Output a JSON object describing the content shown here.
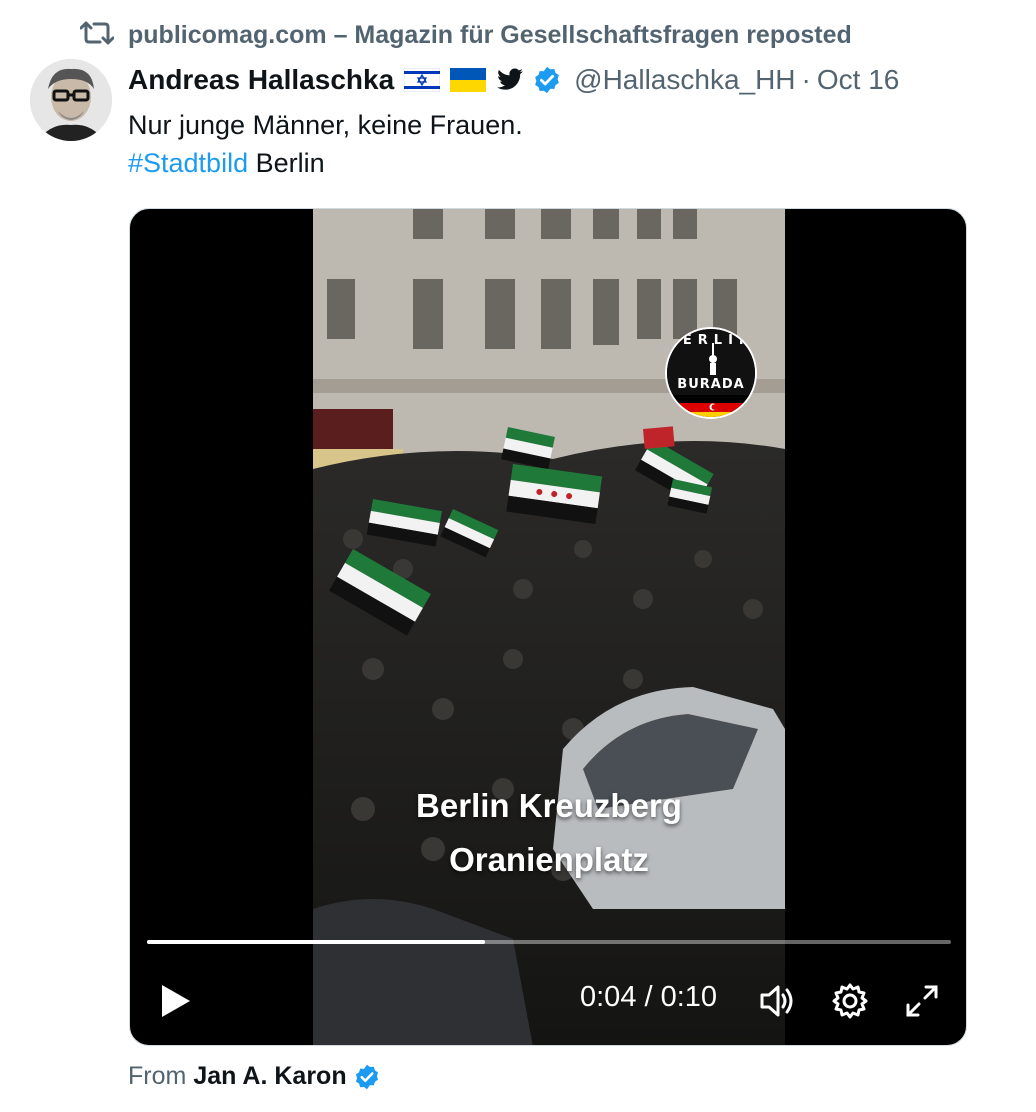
{
  "repost": {
    "text": "publicomag.com – Magazin für Gesellschaftsfragen reposted",
    "icon": "repost-icon"
  },
  "author": {
    "display_name": "Andreas Hallaschka",
    "handle": "@Hallaschka_HH",
    "separator": "·",
    "date": "Oct 16",
    "badges": [
      "israel-flag-icon",
      "ukraine-flag-icon",
      "twitter-bird-icon",
      "verified-badge-icon"
    ]
  },
  "tweet": {
    "line1": "Nur junge Männer, keine Frauen.",
    "hashtag": "#Stadtbild",
    "line2_rest": " Berlin"
  },
  "video": {
    "badge_top": "BERLIN",
    "badge_bottom": "BURADA",
    "caption_line1": "Berlin Kreuzberg",
    "caption_line2": "Oranienplatz",
    "current_time": "0:04",
    "duration": "0:10",
    "time_display": "0:04 / 0:10",
    "progress_fraction": 0.42,
    "controls": [
      "play-icon",
      "volume-icon",
      "settings-gear-icon",
      "fullscreen-icon"
    ]
  },
  "source": {
    "from_label": "From",
    "name": "Jan A. Karon"
  },
  "colors": {
    "link_blue": "#1d9bf0",
    "secondary_text": "#536471",
    "verified_blue": "#1d9bf0"
  }
}
